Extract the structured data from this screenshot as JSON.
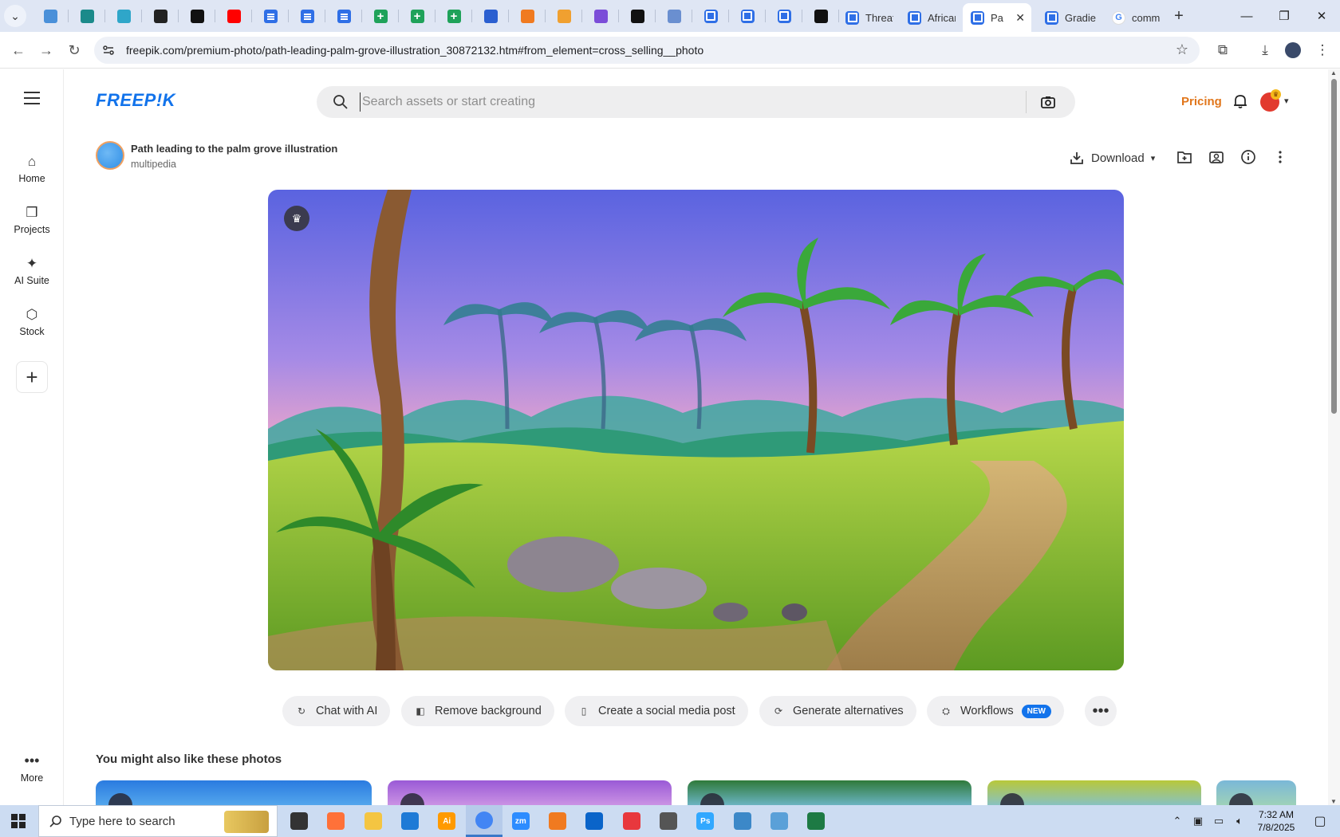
{
  "browser": {
    "pinned_tabs": [
      {
        "icon": "globe-tab-icon",
        "color": "#4a90d9"
      },
      {
        "icon": "shield-tab-icon",
        "color": "#1b8a8a"
      },
      {
        "icon": "arrow-tab-icon",
        "color": "#2fa6c9"
      },
      {
        "icon": "openai-tab-icon",
        "color": "#222222"
      },
      {
        "icon": "bolt-tab-icon",
        "color": "#111111"
      },
      {
        "icon": "youtube-tab-icon",
        "color": "#ff0000"
      },
      {
        "icon": "docs-tab-icon",
        "color": "#2f6fe6"
      },
      {
        "icon": "docs-tab-icon",
        "color": "#2f6fe6"
      },
      {
        "icon": "docs-tab-icon",
        "color": "#2f6fe6"
      },
      {
        "icon": "sheets-tab-icon",
        "color": "#1fa25a"
      },
      {
        "icon": "sheets-tab-icon",
        "color": "#1fa25a"
      },
      {
        "icon": "sheets-tab-icon",
        "color": "#1fa25a"
      },
      {
        "icon": "word-tab-icon",
        "color": "#2b5fd0"
      },
      {
        "icon": "orange-tab-icon",
        "color": "#f07a20"
      },
      {
        "icon": "bird-tab-icon",
        "color": "#f0a030"
      },
      {
        "icon": "code-tab-icon",
        "color": "#7b4dd8"
      },
      {
        "icon": "app-tab-icon",
        "color": "#111111"
      },
      {
        "icon": "grid-tab-icon",
        "color": "#6a8fd0"
      },
      {
        "icon": "forms-tab-icon",
        "color": "#2f6fe6"
      },
      {
        "icon": "forms-tab-icon",
        "color": "#2f6fe6"
      },
      {
        "icon": "forms-tab-icon",
        "color": "#2f6fe6"
      },
      {
        "icon": "m-tab-icon",
        "color": "#111111"
      }
    ],
    "tabs": [
      {
        "title": "Threat"
      },
      {
        "title": "African"
      },
      {
        "title": "Pa"
      },
      {
        "title": "Gradie"
      },
      {
        "title": "comm"
      }
    ],
    "close_glyph": "✕",
    "new_tab_glyph": "+",
    "url": "freepik.com/premium-photo/path-leading-palm-grove-illustration_30872132.htm#from_element=cross_selling__photo"
  },
  "site": {
    "logo": "FREEP!K",
    "search_placeholder": "Search assets or start creating",
    "pricing": "Pricing",
    "brand_color": "#1273eb",
    "accent_color": "#e1761b"
  },
  "sidebar": {
    "items": [
      {
        "label": "Home",
        "icon": "home-icon"
      },
      {
        "label": "Projects",
        "icon": "projects-icon"
      },
      {
        "label": "AI Suite",
        "icon": "sparkle-icon"
      },
      {
        "label": "Stock",
        "icon": "stock-icon"
      }
    ],
    "more_label": "More"
  },
  "asset": {
    "title": "Path leading to the palm grove illustration",
    "author": "multipedia",
    "download_label": "Download"
  },
  "ai_actions": [
    {
      "label": "Chat with AI",
      "icon": "chat-icon"
    },
    {
      "label": "Remove background",
      "icon": "remove-bg-icon"
    },
    {
      "label": "Create a social media post",
      "icon": "phone-icon"
    },
    {
      "label": "Generate alternatives",
      "icon": "refresh-icon"
    },
    {
      "label": "Workflows",
      "icon": "workflow-icon",
      "badge": "NEW"
    }
  ],
  "similar": {
    "heading": "You might also like these photos"
  },
  "taskbar": {
    "search_placeholder": "Type here to search",
    "apps": [
      {
        "icon": "task-view-icon",
        "color": "#333333"
      },
      {
        "icon": "firefox-icon",
        "color": "#ff7139"
      },
      {
        "icon": "file-explorer-icon",
        "color": "#f4c542"
      },
      {
        "icon": "vscode-icon",
        "color": "#1e7ad6"
      },
      {
        "icon": "illustrator-icon",
        "color": "#ff9a00",
        "label": "Ai"
      },
      {
        "icon": "chrome-icon",
        "color": "#4285f4"
      },
      {
        "icon": "zoom-icon",
        "color": "#2d8cff",
        "label": "zm"
      },
      {
        "icon": "xampp-icon",
        "color": "#f07a20"
      },
      {
        "icon": "outlook-icon",
        "color": "#0a64c9"
      },
      {
        "icon": "creative-cloud-icon",
        "color": "#e8383d"
      },
      {
        "icon": "pen-icon",
        "color": "#555555"
      },
      {
        "icon": "photoshop-icon",
        "color": "#31a8ff",
        "label": "Ps"
      },
      {
        "icon": "diamond-app-icon",
        "color": "#3c88c8"
      },
      {
        "icon": "notepad-icon",
        "color": "#5aa0d8"
      },
      {
        "icon": "excel-icon",
        "color": "#1d7a44"
      }
    ],
    "time": "7:32 AM",
    "date": "7/8/2025"
  }
}
